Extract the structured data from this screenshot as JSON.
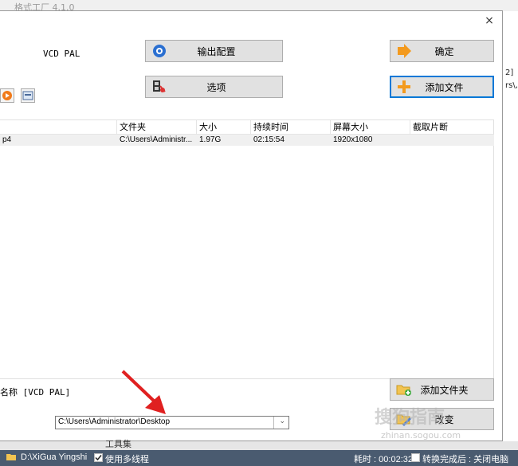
{
  "background": {
    "title": "格式工厂 4.1.0",
    "right_lines": [
      "2]",
      "rs\\,"
    ],
    "bottom_text": "工具集"
  },
  "dialog": {
    "close_glyph": "×",
    "profile_name": "VCD PAL",
    "output_config_label": "输出配置",
    "options_label": "选项",
    "ok_label": "确定",
    "add_file_label": "添加文件",
    "add_folder_label": "添加文件夹",
    "change_label": "改变",
    "folder_name_label": "名称 [VCD PAL]",
    "output_path": "C:\\Users\\Administrator\\Desktop"
  },
  "table": {
    "columns": [
      "",
      "文件夹",
      "大小",
      "持续时间",
      "屏幕大小",
      "截取片断"
    ],
    "rows": [
      {
        "name": "p4",
        "folder": "C:\\Users\\Administr...",
        "size": "1.97G",
        "duration": "02:15:54",
        "screen": "1920x1080",
        "clip": ""
      }
    ]
  },
  "status_bar": {
    "path": "D:\\XiGua Yingshi",
    "multithread_label": "使用多线程",
    "elapsed": "耗时 : 00:02:32",
    "after_done_label": "转换完成后 : 关闭电脑"
  },
  "watermark": {
    "main": "搜狗指南",
    "sub": "zhinan.sogou.com"
  },
  "colors": {
    "status_bar": "#4a5b70",
    "focus": "#0078d7",
    "button_bg": "#e1e1e1"
  }
}
